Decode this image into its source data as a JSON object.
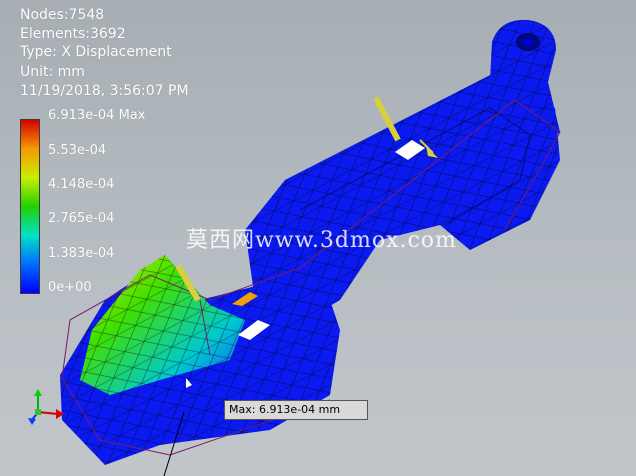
{
  "info": {
    "nodes": "Nodes:7548",
    "elements": "Elements:3692",
    "type": "Type: X Displacement",
    "unit": "Unit: mm",
    "timestamp": "11/19/2018, 3:56:07 PM"
  },
  "legend": {
    "max_label": "6.913e-04 Max",
    "labels": [
      "5.53e-04",
      "4.148e-04",
      "2.765e-04",
      "1.383e-04",
      "0e+00"
    ],
    "colors": [
      "#d40000",
      "#f49a00",
      "#c9ee00",
      "#24d000",
      "#00e2c8",
      "#006cff",
      "#0000ff"
    ]
  },
  "probe": {
    "label": "Max: 6.913e-04 mm"
  },
  "watermark": "莫西网www.3dmox.com",
  "icons": {
    "triad": "axis-triad-icon",
    "model": "stress-mesh-model"
  },
  "colors": {
    "background": "#b4bbc0",
    "mesh_blue": "#0a1af0",
    "load_arrow": "#d7cf3e",
    "wireframe": "#7a1a6a"
  }
}
